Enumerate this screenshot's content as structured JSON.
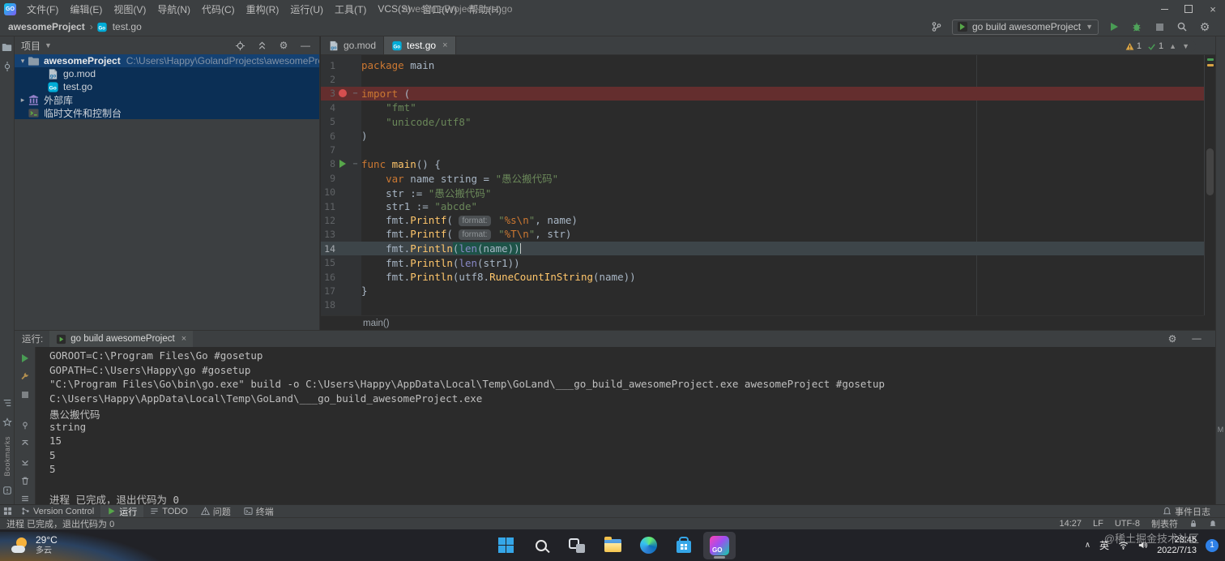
{
  "titlebar": {
    "app": "GO",
    "menus": [
      "文件(F)",
      "编辑(E)",
      "视图(V)",
      "导航(N)",
      "代码(C)",
      "重构(R)",
      "运行(U)",
      "工具(T)",
      "VCS(S)",
      "窗口(W)",
      "帮助(H)"
    ],
    "title": "awesomeProject - test.go"
  },
  "toolbar": {
    "breadcrumb": [
      "awesomeProject",
      "test.go"
    ],
    "run_config": "go build awesomeProject"
  },
  "left_strip": {
    "bookmarks_label": "Bookmarks"
  },
  "right_strip": {
    "label": "M"
  },
  "project": {
    "header": "项目",
    "tree": [
      {
        "chev": "v",
        "icon": "folder",
        "label": "awesomeProject",
        "path": "C:\\Users\\Happy\\GolandProjects\\awesomeProject",
        "lvl": 0,
        "sel": true,
        "bold": true
      },
      {
        "icon": "gomod",
        "label": "go.mod",
        "lvl": 2
      },
      {
        "icon": "gofile",
        "label": "test.go",
        "lvl": 2
      },
      {
        "chev": ">",
        "icon": "lib",
        "label": "外部库",
        "lvl": 0
      },
      {
        "chev": "",
        "icon": "scratch",
        "label": "临时文件和控制台",
        "lvl": 0
      }
    ]
  },
  "editor": {
    "tabs": [
      {
        "icon": "gomod",
        "label": "go.mod",
        "active": false
      },
      {
        "icon": "gofile",
        "label": "test.go",
        "active": true
      }
    ],
    "inspect": {
      "warn": "1",
      "ok": "1"
    },
    "breadcrumb": "main()",
    "lines": [
      {
        "n": 1,
        "t": [
          [
            "k",
            "package"
          ],
          [
            "d",
            " main"
          ]
        ]
      },
      {
        "n": 2,
        "t": []
      },
      {
        "n": 3,
        "g": "bp",
        "bg": "bp",
        "fold": true,
        "t": [
          [
            "k",
            "import"
          ],
          [
            "d",
            " ("
          ]
        ]
      },
      {
        "n": 4,
        "t": [
          [
            "d",
            "    "
          ],
          [
            "s",
            "\"fmt\""
          ]
        ]
      },
      {
        "n": 5,
        "t": [
          [
            "d",
            "    "
          ],
          [
            "s",
            "\"unicode/utf8\""
          ]
        ]
      },
      {
        "n": 6,
        "t": [
          [
            "d",
            ")"
          ]
        ]
      },
      {
        "n": 7,
        "t": []
      },
      {
        "n": 8,
        "g": "run",
        "fold": true,
        "t": [
          [
            "k",
            "func "
          ],
          [
            "f",
            "main"
          ],
          [
            "d",
            "() {"
          ]
        ]
      },
      {
        "n": 9,
        "t": [
          [
            "d",
            "    "
          ],
          [
            "k",
            "var"
          ],
          [
            "d",
            " name string = "
          ],
          [
            "s",
            "\"愚公搬代码\""
          ]
        ]
      },
      {
        "n": 10,
        "t": [
          [
            "d",
            "    str := "
          ],
          [
            "s",
            "\"愚公搬代码\""
          ]
        ]
      },
      {
        "n": 11,
        "t": [
          [
            "d",
            "    str1 := "
          ],
          [
            "s",
            "\"abcde\""
          ]
        ]
      },
      {
        "n": 12,
        "t": [
          [
            "d",
            "    fmt."
          ],
          [
            "f",
            "Printf"
          ],
          [
            "d",
            "( "
          ],
          [
            "h",
            "format:"
          ],
          [
            "d",
            " "
          ],
          [
            "s",
            "\""
          ],
          [
            "e",
            "%s\\n"
          ],
          [
            "s",
            "\""
          ],
          [
            "d",
            ", name)"
          ]
        ]
      },
      {
        "n": 13,
        "t": [
          [
            "d",
            "    fmt."
          ],
          [
            "f",
            "Printf"
          ],
          [
            "d",
            "( "
          ],
          [
            "h",
            "format:"
          ],
          [
            "d",
            " "
          ],
          [
            "s",
            "\""
          ],
          [
            "e",
            "%T\\n"
          ],
          [
            "s",
            "\""
          ],
          [
            "d",
            ", str)"
          ]
        ]
      },
      {
        "n": 14,
        "bg": "cur",
        "t": [
          [
            "d",
            "    fmt."
          ],
          [
            "f",
            "Println"
          ],
          [
            "d",
            "(",
            1
          ],
          [
            "b",
            "len",
            1
          ],
          [
            "d",
            "(name)",
            1
          ],
          [
            "d",
            ")",
            1
          ]
        ]
      },
      {
        "n": 15,
        "t": [
          [
            "d",
            "    fmt."
          ],
          [
            "f",
            "Println"
          ],
          [
            "d",
            "("
          ],
          [
            "b",
            "len"
          ],
          [
            "d",
            "(str1))"
          ]
        ]
      },
      {
        "n": 16,
        "t": [
          [
            "d",
            "    fmt."
          ],
          [
            "f",
            "Println"
          ],
          [
            "d",
            "(utf8."
          ],
          [
            "f",
            "RuneCountInString"
          ],
          [
            "d",
            "(name))"
          ]
        ]
      },
      {
        "n": 17,
        "t": [
          [
            "d",
            "}"
          ]
        ]
      },
      {
        "n": 18,
        "t": []
      }
    ]
  },
  "run": {
    "label": "运行:",
    "tab": "go build awesomeProject",
    "console": [
      "GOROOT=C:\\Program Files\\Go #gosetup",
      "GOPATH=C:\\Users\\Happy\\go #gosetup",
      "\"C:\\Program Files\\Go\\bin\\go.exe\" build -o C:\\Users\\Happy\\AppData\\Local\\Temp\\GoLand\\___go_build_awesomeProject.exe awesomeProject #gosetup",
      "C:\\Users\\Happy\\AppData\\Local\\Temp\\GoLand\\___go_build_awesomeProject.exe",
      "愚公搬代码",
      "string",
      "15",
      "5",
      "5",
      "",
      "进程 已完成，退出代码为 0"
    ]
  },
  "toolwindows": {
    "left": [
      {
        "label": "Version Control",
        "icon": "vcs",
        "active": false
      },
      {
        "label": "运行",
        "icon": "run",
        "active": true
      },
      {
        "label": "TODO",
        "icon": "todo",
        "active": false
      },
      {
        "label": "问题",
        "icon": "problems",
        "active": false
      },
      {
        "label": "终端",
        "icon": "terminal",
        "active": false
      }
    ],
    "right": [
      {
        "label": "事件日志",
        "icon": "log",
        "active": false
      }
    ]
  },
  "status": {
    "message": "进程 已完成，退出代码为 0",
    "caret": "14:27",
    "line_sep": "LF",
    "encoding": "UTF-8",
    "indent": "制表符"
  },
  "taskbar": {
    "weather_temp": "29°C",
    "weather_desc": "多云",
    "apps": [
      "start",
      "search",
      "taskview",
      "explorer",
      "edge",
      "store",
      "goland"
    ],
    "ime": "英",
    "time": "23:45",
    "date": "2022/7/13",
    "badge": "1"
  },
  "watermark": "@稀土掘金技术社区"
}
